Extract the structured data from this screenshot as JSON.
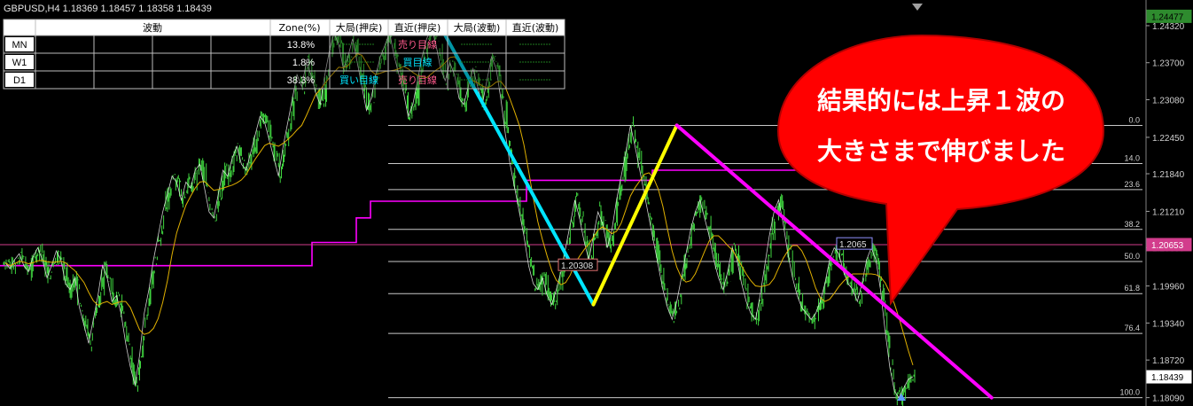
{
  "header": {
    "symbol": "GBPUSD,H4",
    "ohlc": "1.18369 1.18457 1.18358 1.18439"
  },
  "table": {
    "header": [
      "",
      "波動",
      "Zone(%)",
      "大局(押戻)",
      "直近(押戻)",
      "大局(波動)",
      "直近(波動)"
    ],
    "rows": [
      {
        "tf": "MN",
        "zone": "13.8%",
        "big_push": "",
        "near_push": "売り目線",
        "big_wave": "",
        "near_wave": ""
      },
      {
        "tf": "W1",
        "zone": "1.8%",
        "big_push": "",
        "near_push": "買目線",
        "big_wave": "",
        "near_wave": ""
      },
      {
        "tf": "D1",
        "zone": "38.3%",
        "big_push": "買い目線",
        "near_push": "売り目線",
        "big_wave": "",
        "near_wave": ""
      }
    ],
    "colors": {
      "sell": "#ff5a8c",
      "buy": "#00e5ff",
      "dim": "#1e7a1e"
    }
  },
  "callout": {
    "line1": "結果的には上昇１波の",
    "line2": "大きさまで伸びました",
    "fill": "#ff0000",
    "text_color": "#ffffff"
  },
  "chart_data": {
    "type": "line",
    "instrument": "GBPUSD",
    "timeframe": "H4",
    "ylim": [
      1.1795,
      1.2475
    ],
    "y_ticks": [
      1.2432,
      1.237,
      1.2308,
      1.2245,
      1.2184,
      1.2121,
      1.206,
      1.1996,
      1.1934,
      1.1872,
      1.1809
    ],
    "y_tick_labels": [
      "1.24320",
      "1.23700",
      "1.23080",
      "1.22450",
      "1.21840",
      "1.21210",
      "1.20600",
      "1.19960",
      "1.19340",
      "1.18720",
      "1.18090"
    ],
    "price_labels": [
      {
        "text": "1.24477",
        "value": 1.24477,
        "style": "bid-green"
      },
      {
        "text": "1.20653",
        "value": 1.20653,
        "style": "pink"
      },
      {
        "text": "1.18439",
        "value": 1.18439,
        "style": "current"
      }
    ],
    "fibonacci": {
      "high": 1.2265,
      "low": 1.1809,
      "levels": [
        "0.0",
        "14.0",
        "23.6",
        "38.2",
        "50.0",
        "61.8",
        "76.4",
        "100.0"
      ],
      "ratios": [
        0,
        0.14,
        0.236,
        0.382,
        0.5,
        0.618,
        0.764,
        1.0
      ]
    },
    "annotations": [
      {
        "text": "1.20308",
        "value": 1.20308
      },
      {
        "text": "1.2065",
        "value": 1.2065
      }
    ],
    "horizontal_line": {
      "value": 1.20653,
      "color": "#d23c8c"
    },
    "price_series": [
      1.2035,
      1.2025,
      1.204,
      1.205,
      1.203,
      1.202,
      1.2045,
      1.206,
      1.204,
      1.201,
      1.203,
      1.2055,
      1.204,
      1.2,
      1.199,
      1.201,
      1.196,
      1.193,
      1.19,
      1.194,
      1.198,
      1.203,
      1.201,
      1.197,
      1.198,
      1.195,
      1.19,
      1.186,
      1.183,
      1.188,
      1.195,
      1.199,
      1.204,
      1.208,
      1.212,
      1.215,
      1.218,
      1.217,
      1.214,
      1.217,
      1.216,
      1.219,
      1.22,
      1.216,
      1.212,
      1.211,
      1.215,
      1.219,
      1.218,
      1.221,
      1.223,
      1.22,
      1.219,
      1.222,
      1.225,
      1.228,
      1.227,
      1.224,
      1.221,
      1.218,
      1.223,
      1.227,
      1.231,
      1.235,
      1.233,
      1.237,
      1.235,
      1.232,
      1.23,
      1.235,
      1.239,
      1.242,
      1.24,
      1.236,
      1.238,
      1.241,
      1.237,
      1.233,
      1.229,
      1.231,
      1.235,
      1.238,
      1.24,
      1.242,
      1.238,
      1.235,
      1.232,
      1.228,
      1.23,
      1.234,
      1.238,
      1.241,
      1.243,
      1.24,
      1.236,
      1.234,
      1.237,
      1.235,
      1.231,
      1.23,
      1.233,
      1.236,
      1.233,
      1.23,
      1.234,
      1.238,
      1.236,
      1.231,
      1.225,
      1.22,
      1.216,
      1.212,
      1.208,
      1.203,
      1.2,
      1.199,
      1.201,
      1.198,
      1.1965,
      1.199,
      1.202,
      1.206,
      1.21,
      1.214,
      1.211,
      1.207,
      1.204,
      1.208,
      1.212,
      1.21,
      1.206,
      1.209,
      1.214,
      1.218,
      1.222,
      1.2265,
      1.223,
      1.219,
      1.215,
      1.211,
      1.207,
      1.203,
      1.199,
      1.196,
      1.194,
      1.197,
      1.201,
      1.205,
      1.209,
      1.212,
      1.214,
      1.211,
      1.208,
      1.204,
      1.201,
      1.199,
      1.202,
      1.206,
      1.204,
      1.2,
      1.197,
      1.195,
      1.194,
      1.198,
      1.203,
      1.208,
      1.212,
      1.214,
      1.21,
      1.205,
      1.201,
      1.198,
      1.196,
      1.195,
      1.194,
      1.195,
      1.197,
      1.2,
      1.204,
      1.206,
      1.205,
      1.202,
      1.2,
      1.199,
      1.197,
      1.2,
      1.204,
      1.206,
      1.204,
      1.199,
      1.192,
      1.186,
      1.182,
      1.1809,
      1.1825,
      1.184,
      1.1844
    ],
    "series": [
      {
        "kind": "zigzag",
        "color": "#00e5ff",
        "points": [
          [
            94,
            1.243
          ],
          [
            127,
            1.1965
          ]
        ]
      },
      {
        "kind": "zigzag",
        "color": "#ffff00",
        "points": [
          [
            127,
            1.1965
          ],
          [
            145,
            1.2265
          ]
        ]
      },
      {
        "kind": "zigzag",
        "color": "#ff00ff",
        "points": [
          [
            145,
            1.2265
          ],
          [
            213,
            1.1809
          ]
        ]
      }
    ]
  }
}
